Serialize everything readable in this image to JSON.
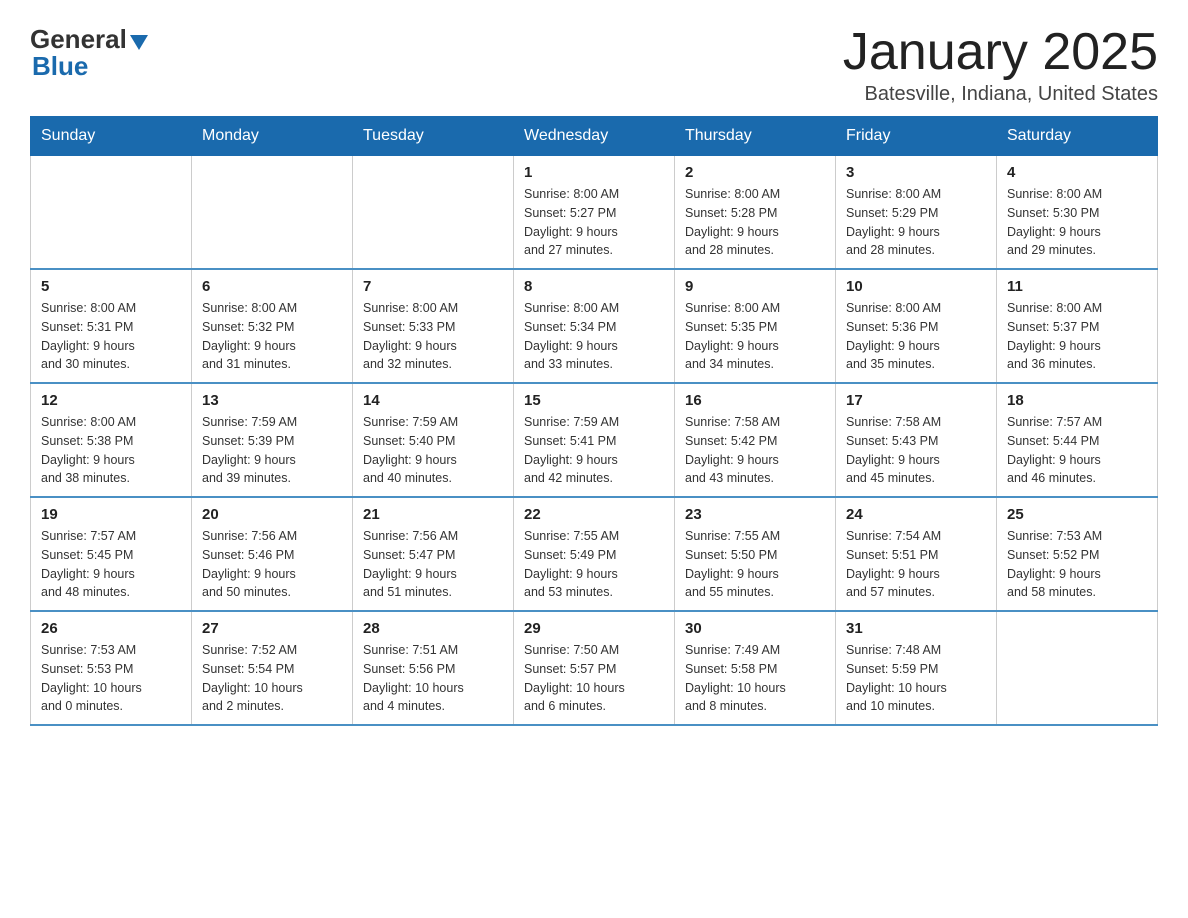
{
  "header": {
    "logo_line1": "General",
    "logo_line2": "Blue",
    "title": "January 2025",
    "subtitle": "Batesville, Indiana, United States"
  },
  "days_of_week": [
    "Sunday",
    "Monday",
    "Tuesday",
    "Wednesday",
    "Thursday",
    "Friday",
    "Saturday"
  ],
  "weeks": [
    [
      {
        "day": "",
        "info": ""
      },
      {
        "day": "",
        "info": ""
      },
      {
        "day": "",
        "info": ""
      },
      {
        "day": "1",
        "info": "Sunrise: 8:00 AM\nSunset: 5:27 PM\nDaylight: 9 hours\nand 27 minutes."
      },
      {
        "day": "2",
        "info": "Sunrise: 8:00 AM\nSunset: 5:28 PM\nDaylight: 9 hours\nand 28 minutes."
      },
      {
        "day": "3",
        "info": "Sunrise: 8:00 AM\nSunset: 5:29 PM\nDaylight: 9 hours\nand 28 minutes."
      },
      {
        "day": "4",
        "info": "Sunrise: 8:00 AM\nSunset: 5:30 PM\nDaylight: 9 hours\nand 29 minutes."
      }
    ],
    [
      {
        "day": "5",
        "info": "Sunrise: 8:00 AM\nSunset: 5:31 PM\nDaylight: 9 hours\nand 30 minutes."
      },
      {
        "day": "6",
        "info": "Sunrise: 8:00 AM\nSunset: 5:32 PM\nDaylight: 9 hours\nand 31 minutes."
      },
      {
        "day": "7",
        "info": "Sunrise: 8:00 AM\nSunset: 5:33 PM\nDaylight: 9 hours\nand 32 minutes."
      },
      {
        "day": "8",
        "info": "Sunrise: 8:00 AM\nSunset: 5:34 PM\nDaylight: 9 hours\nand 33 minutes."
      },
      {
        "day": "9",
        "info": "Sunrise: 8:00 AM\nSunset: 5:35 PM\nDaylight: 9 hours\nand 34 minutes."
      },
      {
        "day": "10",
        "info": "Sunrise: 8:00 AM\nSunset: 5:36 PM\nDaylight: 9 hours\nand 35 minutes."
      },
      {
        "day": "11",
        "info": "Sunrise: 8:00 AM\nSunset: 5:37 PM\nDaylight: 9 hours\nand 36 minutes."
      }
    ],
    [
      {
        "day": "12",
        "info": "Sunrise: 8:00 AM\nSunset: 5:38 PM\nDaylight: 9 hours\nand 38 minutes."
      },
      {
        "day": "13",
        "info": "Sunrise: 7:59 AM\nSunset: 5:39 PM\nDaylight: 9 hours\nand 39 minutes."
      },
      {
        "day": "14",
        "info": "Sunrise: 7:59 AM\nSunset: 5:40 PM\nDaylight: 9 hours\nand 40 minutes."
      },
      {
        "day": "15",
        "info": "Sunrise: 7:59 AM\nSunset: 5:41 PM\nDaylight: 9 hours\nand 42 minutes."
      },
      {
        "day": "16",
        "info": "Sunrise: 7:58 AM\nSunset: 5:42 PM\nDaylight: 9 hours\nand 43 minutes."
      },
      {
        "day": "17",
        "info": "Sunrise: 7:58 AM\nSunset: 5:43 PM\nDaylight: 9 hours\nand 45 minutes."
      },
      {
        "day": "18",
        "info": "Sunrise: 7:57 AM\nSunset: 5:44 PM\nDaylight: 9 hours\nand 46 minutes."
      }
    ],
    [
      {
        "day": "19",
        "info": "Sunrise: 7:57 AM\nSunset: 5:45 PM\nDaylight: 9 hours\nand 48 minutes."
      },
      {
        "day": "20",
        "info": "Sunrise: 7:56 AM\nSunset: 5:46 PM\nDaylight: 9 hours\nand 50 minutes."
      },
      {
        "day": "21",
        "info": "Sunrise: 7:56 AM\nSunset: 5:47 PM\nDaylight: 9 hours\nand 51 minutes."
      },
      {
        "day": "22",
        "info": "Sunrise: 7:55 AM\nSunset: 5:49 PM\nDaylight: 9 hours\nand 53 minutes."
      },
      {
        "day": "23",
        "info": "Sunrise: 7:55 AM\nSunset: 5:50 PM\nDaylight: 9 hours\nand 55 minutes."
      },
      {
        "day": "24",
        "info": "Sunrise: 7:54 AM\nSunset: 5:51 PM\nDaylight: 9 hours\nand 57 minutes."
      },
      {
        "day": "25",
        "info": "Sunrise: 7:53 AM\nSunset: 5:52 PM\nDaylight: 9 hours\nand 58 minutes."
      }
    ],
    [
      {
        "day": "26",
        "info": "Sunrise: 7:53 AM\nSunset: 5:53 PM\nDaylight: 10 hours\nand 0 minutes."
      },
      {
        "day": "27",
        "info": "Sunrise: 7:52 AM\nSunset: 5:54 PM\nDaylight: 10 hours\nand 2 minutes."
      },
      {
        "day": "28",
        "info": "Sunrise: 7:51 AM\nSunset: 5:56 PM\nDaylight: 10 hours\nand 4 minutes."
      },
      {
        "day": "29",
        "info": "Sunrise: 7:50 AM\nSunset: 5:57 PM\nDaylight: 10 hours\nand 6 minutes."
      },
      {
        "day": "30",
        "info": "Sunrise: 7:49 AM\nSunset: 5:58 PM\nDaylight: 10 hours\nand 8 minutes."
      },
      {
        "day": "31",
        "info": "Sunrise: 7:48 AM\nSunset: 5:59 PM\nDaylight: 10 hours\nand 10 minutes."
      },
      {
        "day": "",
        "info": ""
      }
    ]
  ]
}
